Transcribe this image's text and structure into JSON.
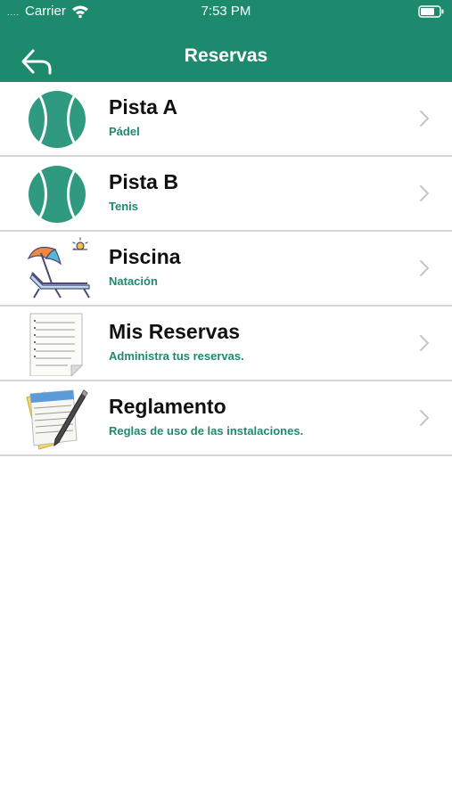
{
  "status_bar": {
    "signal": "....",
    "carrier": "Carrier",
    "time": "7:53 PM",
    "icons": [
      "wifi-icon",
      "battery-icon"
    ]
  },
  "nav": {
    "title": "Reservas",
    "back_icon": "back-arrow-icon"
  },
  "colors": {
    "brand": "#1d8a6e",
    "subtitle": "#1d8a6e",
    "title_text": "#111111",
    "separator": "#d6d6d6",
    "chevron": "#c4c4c4"
  },
  "items": [
    {
      "title": "Pista A",
      "subtitle": "Pádel",
      "icon": "tennis-ball-icon"
    },
    {
      "title": "Pista B",
      "subtitle": "Tenis",
      "icon": "tennis-ball-icon"
    },
    {
      "title": "Piscina",
      "subtitle": "Natación",
      "icon": "sunbed-umbrella-icon"
    },
    {
      "title": "Mis Reservas",
      "subtitle": "Administra tus reservas.",
      "icon": "document-list-icon"
    },
    {
      "title": "Reglamento",
      "subtitle": "Reglas de uso de las instalaciones.",
      "icon": "notepad-pen-icon"
    }
  ]
}
